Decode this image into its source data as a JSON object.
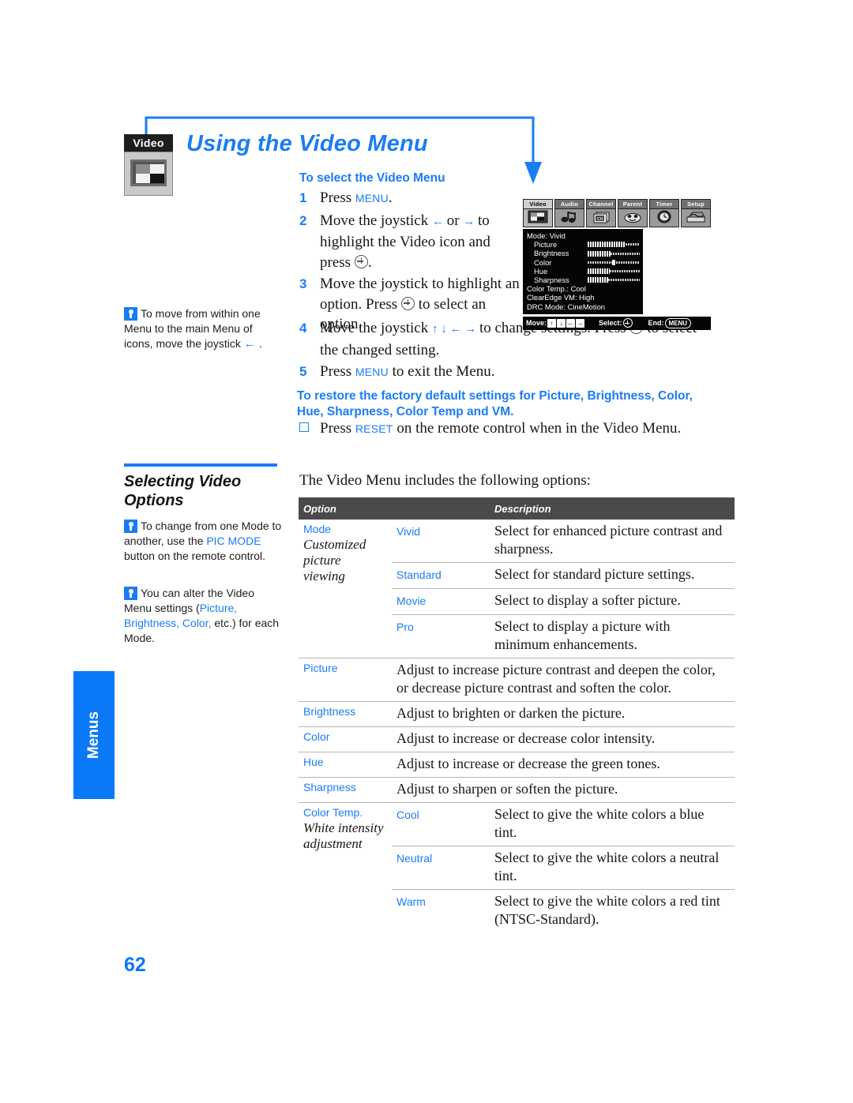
{
  "document": {
    "page_number": "62",
    "side_tab": "Menus",
    "title": "Using the Video Menu",
    "badge_label": "Video"
  },
  "procedure": {
    "heading": "To select the Video Menu",
    "steps": [
      {
        "num": "1",
        "parts": [
          {
            "t": "text",
            "v": "Press "
          },
          {
            "t": "kbd",
            "v": "MENU"
          },
          {
            "t": "text",
            "v": "."
          }
        ]
      },
      {
        "num": "2",
        "parts": [
          {
            "t": "text",
            "v": "Move the joystick "
          },
          {
            "t": "arrow",
            "v": "left"
          },
          {
            "t": "text",
            "v": " or "
          },
          {
            "t": "arrow",
            "v": "right"
          },
          {
            "t": "text",
            "v": " to highlight the Video icon and press "
          },
          {
            "t": "plus",
            "v": ""
          },
          {
            "t": "text",
            "v": "."
          }
        ]
      },
      {
        "num": "3",
        "parts": [
          {
            "t": "text",
            "v": "Move the joystick to highlight an option. Press "
          },
          {
            "t": "plus",
            "v": ""
          },
          {
            "t": "text",
            "v": " to select an option."
          }
        ]
      },
      {
        "num": "4",
        "parts": [
          {
            "t": "text",
            "v": "Move the joystick "
          },
          {
            "t": "arrow",
            "v": "up"
          },
          {
            "t": "arrow",
            "v": "down"
          },
          {
            "t": "arrow",
            "v": "left"
          },
          {
            "t": "arrow",
            "v": "right"
          },
          {
            "t": "text",
            "v": " to change settings. Press "
          },
          {
            "t": "plus",
            "v": ""
          },
          {
            "t": "text",
            "v": " to select the changed setting."
          }
        ]
      },
      {
        "num": "5",
        "parts": [
          {
            "t": "text",
            "v": "Press "
          },
          {
            "t": "kbd",
            "v": "MENU"
          },
          {
            "t": "text",
            "v": " to exit the Menu."
          }
        ]
      }
    ]
  },
  "reset": {
    "heading": "To restore the factory default settings for Picture, Brightness, Color, Hue, Sharpness, Color Temp and VM.",
    "item_parts": [
      {
        "t": "text",
        "v": "Press "
      },
      {
        "t": "kbd",
        "v": "RESET"
      },
      {
        "t": "text",
        "v": " on the remote control when in the Video Menu."
      }
    ]
  },
  "osd": {
    "tabs": [
      {
        "label": "Video",
        "icon": "video-icon",
        "selected": true
      },
      {
        "label": "Audio",
        "icon": "audio-icon",
        "selected": false
      },
      {
        "label": "Channel",
        "icon": "channel-icon",
        "selected": false
      },
      {
        "label": "Parent",
        "icon": "parent-icon",
        "selected": false
      },
      {
        "label": "Timer",
        "icon": "timer-icon",
        "selected": false
      },
      {
        "label": "Setup",
        "icon": "setup-icon",
        "selected": false
      }
    ],
    "lines": [
      {
        "label": "Mode: Vivid",
        "indent": false,
        "bar": null
      },
      {
        "label": "Picture",
        "indent": true,
        "bar": {
          "type": "fill",
          "percent": 72
        }
      },
      {
        "label": "Brightness",
        "indent": true,
        "bar": {
          "type": "fill",
          "percent": 44
        }
      },
      {
        "label": "Color",
        "indent": true,
        "bar": {
          "type": "knob",
          "percent": 50
        }
      },
      {
        "label": "Hue",
        "indent": true,
        "bar": {
          "type": "fill",
          "percent": 42
        }
      },
      {
        "label": "Sharpness",
        "indent": true,
        "bar": {
          "type": "fill",
          "percent": 40
        }
      },
      {
        "label": "Color Temp.: Cool",
        "indent": false,
        "bar": null
      },
      {
        "label": "ClearEdge VM: High",
        "indent": false,
        "bar": null
      },
      {
        "label": "DRC Mode: CineMotion",
        "indent": false,
        "bar": null
      }
    ],
    "footer": {
      "move_label": "Move:",
      "move_keys": [
        "↑",
        "↓",
        "←",
        "→"
      ],
      "select_label": "Select:",
      "end_label": "End:",
      "end_key": "MENU"
    }
  },
  "notes": {
    "move_note": [
      {
        "t": "tip"
      },
      {
        "t": "text",
        "v": "To move from within one Menu to the main Menu of icons, move the joystick "
      },
      {
        "t": "arrow",
        "v": "left"
      },
      {
        "t": "text",
        "v": "."
      }
    ],
    "mode_note": [
      {
        "t": "tip"
      },
      {
        "t": "text",
        "v": "To change from one Mode to another, use the "
      },
      {
        "t": "hl",
        "v": "PIC MODE"
      },
      {
        "t": "text",
        "v": " button on the remote control."
      }
    ],
    "alter_note": [
      {
        "t": "tip"
      },
      {
        "t": "text",
        "v": "You can alter the Video Menu settings ("
      },
      {
        "t": "hl",
        "v": "Picture, Brightness, Color,"
      },
      {
        "t": "text",
        "v": " etc.) for each Mode."
      }
    ]
  },
  "section": {
    "title": "Selecting Video Options",
    "intro": "The Video Menu includes the following options:"
  },
  "table": {
    "headers": [
      "Option",
      "Description"
    ],
    "rows": [
      {
        "option": "Mode",
        "option_sub": "Customized picture viewing",
        "option_rowspan": 4,
        "value": "Vivid",
        "description": "Select for enhanced picture contrast and sharpness.",
        "first_in_group": true
      },
      {
        "option": "",
        "option_sub": "",
        "value": "Standard",
        "description": "Select for standard picture settings.",
        "first_in_group": false
      },
      {
        "option": "",
        "option_sub": "",
        "value": "Movie",
        "description": "Select to display a softer picture.",
        "first_in_group": false
      },
      {
        "option": "",
        "option_sub": "",
        "value": "Pro",
        "description": "Select to display a picture with minimum enhancements.",
        "first_in_group": false
      },
      {
        "option": "Picture",
        "option_sub": "",
        "value": "",
        "description": "Adjust to increase picture contrast and deepen the color, or decrease picture contrast and soften the color.",
        "first_in_group": true,
        "span": true
      },
      {
        "option": "Brightness",
        "option_sub": "",
        "value": "",
        "description": "Adjust to brighten or darken the picture.",
        "first_in_group": true,
        "span": true
      },
      {
        "option": "Color",
        "option_sub": "",
        "value": "",
        "description": "Adjust to increase or decrease color intensity.",
        "first_in_group": true,
        "span": true
      },
      {
        "option": "Hue",
        "option_sub": "",
        "value": "",
        "description": "Adjust to increase or decrease the green tones.",
        "first_in_group": true,
        "span": true
      },
      {
        "option": "Sharpness",
        "option_sub": "",
        "value": "",
        "description": "Adjust to sharpen or soften the picture.",
        "first_in_group": true,
        "span": true
      },
      {
        "option": "Color Temp.",
        "option_sub": "White intensity adjustment",
        "option_rowspan": 3,
        "value": "Cool",
        "description": "Select to give the white colors a blue tint.",
        "first_in_group": true
      },
      {
        "option": "",
        "option_sub": "",
        "value": "Neutral",
        "description": "Select to give the white colors a neutral tint.",
        "first_in_group": false
      },
      {
        "option": "",
        "option_sub": "",
        "value": "Warm",
        "description": "Select to give the white colors a red tint (NTSC-Standard).",
        "first_in_group": false
      }
    ]
  },
  "colors": {
    "accent_blue": "#1a7cf5",
    "tab_blue": "#0b79f7",
    "table_header_bg": "#4a4a4a",
    "rule_gray": "#b5b5b5"
  }
}
